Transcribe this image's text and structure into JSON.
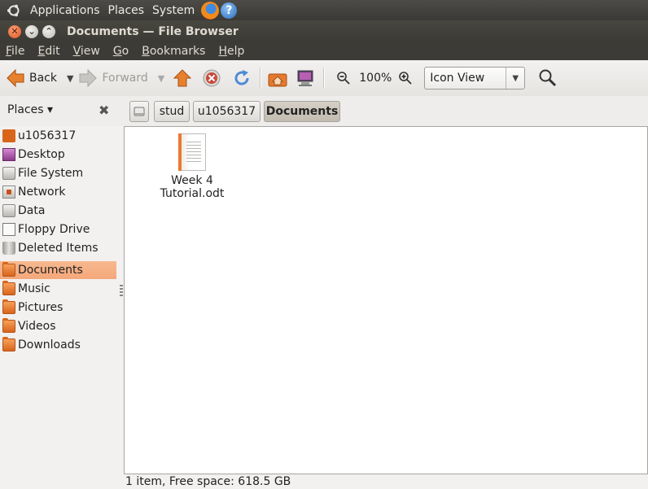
{
  "panel": {
    "menus": [
      "Applications",
      "Places",
      "System"
    ],
    "firefox_icon": "firefox-icon",
    "help_icon": "?"
  },
  "window": {
    "title": "Documents — File Browser"
  },
  "menubar": {
    "items": [
      {
        "accel": "F",
        "rest": "ile"
      },
      {
        "accel": "E",
        "rest": "dit"
      },
      {
        "accel": "V",
        "rest": "iew"
      },
      {
        "accel": "G",
        "rest": "o"
      },
      {
        "accel": "B",
        "rest": "ookmarks"
      },
      {
        "accel": "H",
        "rest": "elp"
      }
    ]
  },
  "toolbar": {
    "back": "Back",
    "forward": "Forward",
    "zoom": "100%",
    "view_mode": "Icon View"
  },
  "location": {
    "places_label": "Places",
    "crumbs": [
      "stud",
      "u1056317",
      "Documents"
    ]
  },
  "sidebar": {
    "items": [
      {
        "label": "u1056317",
        "icon": "home-folder-icon"
      },
      {
        "label": "Desktop",
        "icon": "desktop-icon"
      },
      {
        "label": "File System",
        "icon": "drive-icon"
      },
      {
        "label": "Network",
        "icon": "network-icon"
      },
      {
        "label": "Data",
        "icon": "drive-icon"
      },
      {
        "label": "Floppy Drive",
        "icon": "floppy-icon"
      },
      {
        "label": "Deleted Items",
        "icon": "trash-icon"
      },
      {
        "label": "Documents",
        "icon": "folder-icon",
        "selected": true
      },
      {
        "label": "Music",
        "icon": "folder-icon"
      },
      {
        "label": "Pictures",
        "icon": "folder-icon"
      },
      {
        "label": "Videos",
        "icon": "folder-icon"
      },
      {
        "label": "Downloads",
        "icon": "folder-icon"
      }
    ]
  },
  "files": [
    {
      "name": "Week 4 Tutorial.odt",
      "icon": "odt-document-icon"
    }
  ],
  "status": "1 item, Free space: 618.5 GB",
  "colors": {
    "panel": "#3c3b37",
    "selection": "#f4a77a",
    "folder": "#d9651b"
  }
}
